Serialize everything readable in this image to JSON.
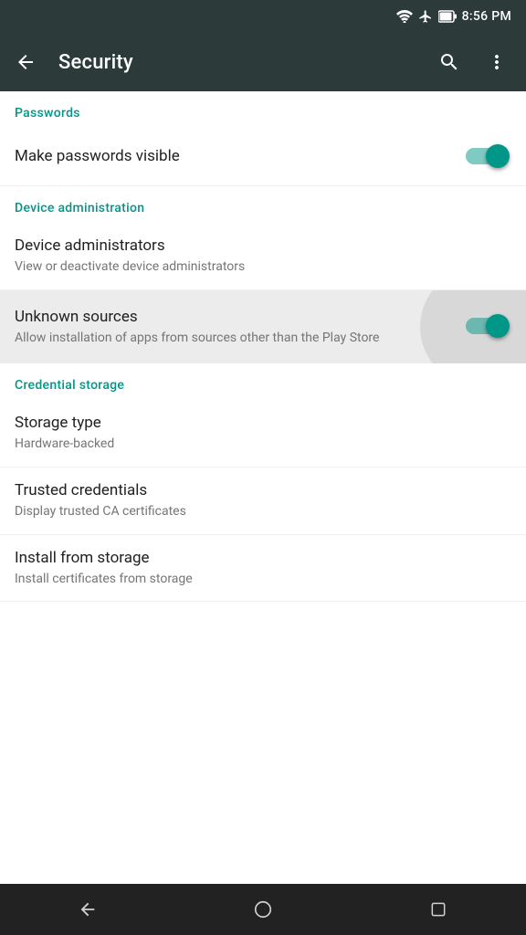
{
  "statusBar": {
    "time": "8:56 PM"
  },
  "toolbar": {
    "backLabel": "←",
    "title": "Security",
    "searchLabel": "search",
    "moreLabel": "more"
  },
  "sections": [
    {
      "id": "passwords",
      "header": "Passwords",
      "items": [
        {
          "id": "make-passwords-visible",
          "title": "Make passwords visible",
          "subtitle": "",
          "hasToggle": true,
          "toggleOn": true,
          "highlighted": false
        }
      ]
    },
    {
      "id": "device-administration",
      "header": "Device administration",
      "items": [
        {
          "id": "device-administrators",
          "title": "Device administrators",
          "subtitle": "View or deactivate device administrators",
          "hasToggle": false,
          "highlighted": false
        },
        {
          "id": "unknown-sources",
          "title": "Unknown sources",
          "subtitle": "Allow installation of apps from sources other than the Play Store",
          "hasToggle": true,
          "toggleOn": true,
          "highlighted": true
        }
      ]
    },
    {
      "id": "credential-storage",
      "header": "Credential storage",
      "items": [
        {
          "id": "storage-type",
          "title": "Storage type",
          "subtitle": "Hardware-backed",
          "hasToggle": false,
          "highlighted": false
        },
        {
          "id": "trusted-credentials",
          "title": "Trusted credentials",
          "subtitle": "Display trusted CA certificates",
          "hasToggle": false,
          "highlighted": false
        },
        {
          "id": "install-from-storage",
          "title": "Install from storage",
          "subtitle": "Install certificates from storage",
          "hasToggle": false,
          "highlighted": false
        }
      ]
    }
  ],
  "navBar": {
    "backLabel": "back",
    "homeLabel": "home",
    "recentLabel": "recent"
  }
}
